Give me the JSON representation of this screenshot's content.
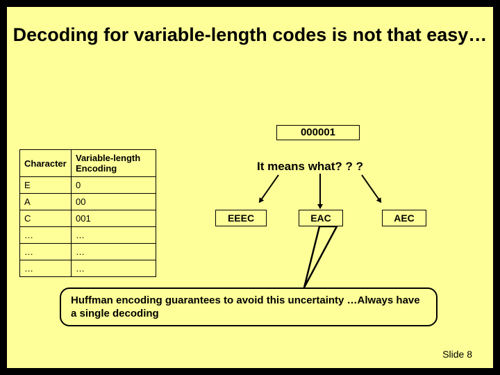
{
  "title": "Decoding for variable-length codes is not that easy…",
  "table": {
    "headers": [
      "Character",
      "Variable-length Encoding"
    ],
    "rows": [
      {
        "char": "E",
        "code": "0"
      },
      {
        "char": "A",
        "code": "00"
      },
      {
        "char": "C",
        "code": "001"
      },
      {
        "char": "…",
        "code": "…"
      },
      {
        "char": "…",
        "code": "…"
      },
      {
        "char": "…",
        "code": "…"
      }
    ]
  },
  "encoded": "000001",
  "question": "It means what? ? ?",
  "interpretations": [
    "EEEC",
    "EAC",
    "AEC"
  ],
  "callout": "Huffman encoding guarantees to avoid this uncertainty …Always have a single decoding",
  "footer": "Slide 8"
}
